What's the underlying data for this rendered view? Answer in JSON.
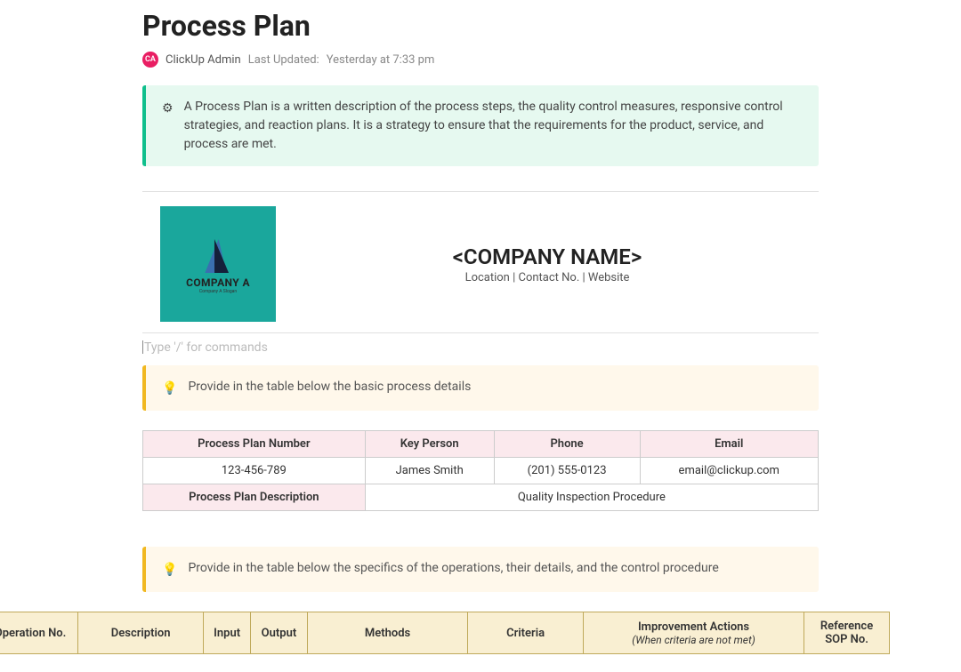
{
  "title": "Process Plan",
  "meta": {
    "avatar_initials": "CA",
    "author": "ClickUp Admin",
    "updated_label": "Last Updated:",
    "updated_value": "Yesterday at 7:33 pm"
  },
  "intro_callout": {
    "text": "A Process Plan is a written description of the process steps, the quality control measures, responsive control strategies, and reaction plans. It is a strategy to ensure that the requirements for the product, service, and process are met."
  },
  "company": {
    "logo_name": "COMPANY A",
    "logo_slogan": "Company A Slogan",
    "name": "<COMPANY NAME>",
    "subline": "Location | Contact No. | Website"
  },
  "editor": {
    "placeholder": "Type '/' for commands"
  },
  "callout_basic": {
    "text": "Provide in the table below the basic process details"
  },
  "info_table": {
    "headers": {
      "plan_number": "Process Plan Number",
      "key_person": "Key Person",
      "phone": "Phone",
      "email": "Email"
    },
    "row": {
      "plan_number": "123-456-789",
      "key_person": "James Smith",
      "phone": "(201) 555-0123",
      "email": "email@clickup.com"
    },
    "desc_label": "Process Plan Description",
    "desc_value": "Quality Inspection Procedure"
  },
  "callout_ops": {
    "text": "Provide in the table below the specifics of the operations, their details, and the control procedure"
  },
  "ops_table": {
    "headers": {
      "op_no": "Operation No.",
      "description": "Description",
      "input": "Input",
      "output": "Output",
      "methods": "Methods",
      "criteria": "Criteria",
      "improvement": "Improvement Actions",
      "improvement_sub": "(When criteria are not met)",
      "reference": "Reference SOP No."
    }
  }
}
